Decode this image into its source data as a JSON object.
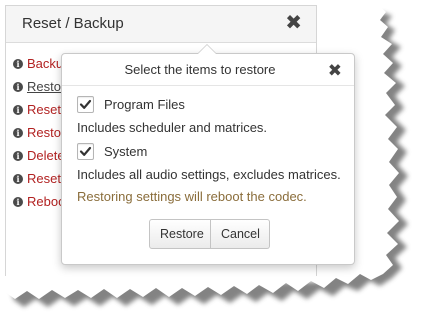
{
  "panel": {
    "title": "Reset / Backup",
    "close_glyph": "✖",
    "items": [
      {
        "label": "Backu",
        "icon": "info-icon"
      },
      {
        "label": "Resto",
        "icon": "info-icon",
        "selected": true
      },
      {
        "label": "Reset",
        "icon": "info-icon"
      },
      {
        "label": "Resto",
        "icon": "info-icon"
      },
      {
        "label": "Delete",
        "icon": "info-icon"
      },
      {
        "label": "Reset",
        "icon": "info-icon"
      },
      {
        "label": "Reboo",
        "icon": "info-icon"
      }
    ]
  },
  "popover": {
    "title": "Select the items to restore",
    "close_glyph": "✖",
    "options": [
      {
        "label": "Program Files",
        "checked": true,
        "description": "Includes scheduler and matrices."
      },
      {
        "label": "System",
        "checked": true,
        "description": "Includes all audio settings, excludes matrices."
      }
    ],
    "warning": "Restoring settings will reboot the codec.",
    "buttons": {
      "restore": "Restore",
      "cancel": "Cancel"
    }
  },
  "colors": {
    "menu_link": "#b22222",
    "warning_text": "#8a6d3b",
    "header_bg": "#f5f5f5"
  }
}
